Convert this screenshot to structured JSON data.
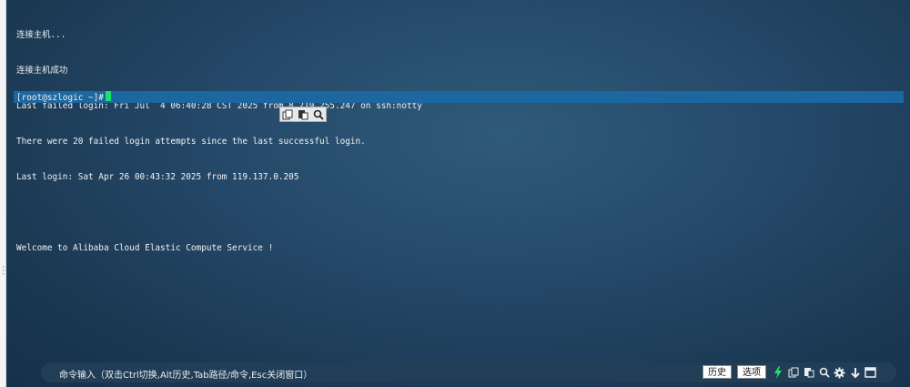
{
  "terminal": {
    "lines": [
      "连接主机...",
      "连接主机成功",
      "Last failed login: Fri Jul  4 06:40:28 CST 2025 from 8.219.255.247 on ssh:notty",
      "There were 20 failed login attempts since the last successful login.",
      "Last login: Sat Apr 26 00:43:32 2025 from 119.137.0.205",
      "",
      "Welcome to Alibaba Cloud Elastic Compute Service !",
      ""
    ],
    "prompt": "[root@szlogic ~]#"
  },
  "popup_toolbar": {
    "icons": [
      "copy-icon",
      "paste-icon",
      "search-icon"
    ]
  },
  "command_bar": {
    "hint": "命令输入（双击Ctrl切换,Alt历史,Tab路径/命令,Esc关闭窗口）",
    "history_label": "历史",
    "options_label": "选项",
    "icons": [
      "lightning-icon",
      "copy-icon",
      "paste-icon",
      "search-icon",
      "gear-icon",
      "arrow-down-icon",
      "maximize-icon"
    ],
    "colors": {
      "lightning": "#22e06a",
      "bar_bg": "#213e56"
    }
  }
}
